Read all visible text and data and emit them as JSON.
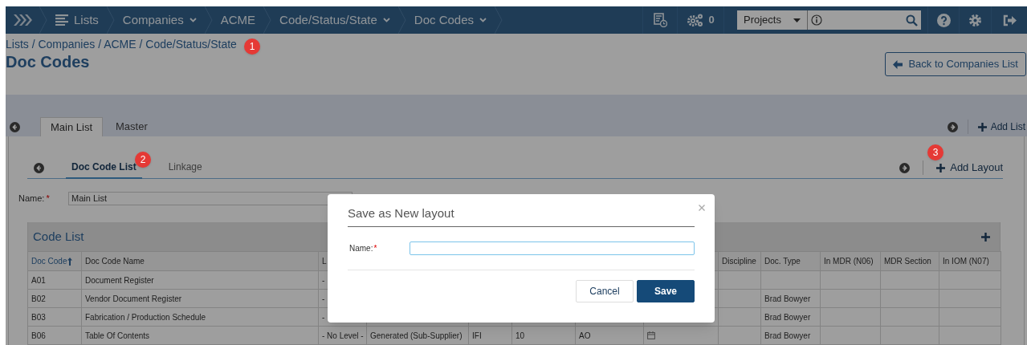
{
  "nav": {
    "items": [
      {
        "label": "Lists",
        "dropdown": false
      },
      {
        "label": "Companies",
        "dropdown": true
      },
      {
        "label": "ACME",
        "dropdown": false
      },
      {
        "label": "Code/Status/State",
        "dropdown": true
      },
      {
        "label": "Doc Codes",
        "dropdown": true
      }
    ],
    "job_count": "0",
    "project_select": "Projects"
  },
  "page": {
    "breadcrumb": "Lists / Companies / ACME / Code/Status/State",
    "title": "Doc Codes",
    "back_button": "Back to Companies List"
  },
  "list_tabs": [
    {
      "label": "Main List",
      "selected": true
    },
    {
      "label": "Master",
      "selected": false
    }
  ],
  "add_list": "Add List",
  "layout_tabs": [
    {
      "label": "Doc Code List",
      "selected": true
    },
    {
      "label": "Linkage",
      "selected": false
    }
  ],
  "add_layout": "Add Layout",
  "name_field": {
    "label": "Name:",
    "required_mark": "*",
    "value": "Main List"
  },
  "table": {
    "title": "Code List",
    "columns": [
      {
        "label": "Doc Code",
        "sorted": true
      },
      {
        "label": "Doc Code Name",
        "sorted": false
      },
      {
        "label": "L",
        "sorted": false
      },
      {},
      {},
      {},
      {},
      {},
      {
        "label": "Discipline",
        "sorted": false
      },
      {
        "label": "Doc. Type",
        "sorted": false
      },
      {
        "label": "In MDR (N06)",
        "sorted": false
      },
      {
        "label": "MDR Section",
        "sorted": false
      },
      {
        "label": "In IOM (N07)",
        "sorted": false
      }
    ],
    "rows": [
      {
        "cells": [
          "A01",
          "Document Register",
          "-",
          null,
          null,
          null,
          null,
          null,
          null,
          null,
          null,
          null,
          null
        ]
      },
      {
        "cells": [
          "B02",
          "Vendor Document Register",
          "-",
          null,
          null,
          null,
          null,
          null,
          null,
          "Brad Bowyer",
          null,
          null,
          null
        ]
      },
      {
        "cells": [
          "B03",
          "Fabrication / Production Schedule",
          "-",
          null,
          null,
          null,
          null,
          null,
          null,
          "Brad Bowyer",
          null,
          null,
          null
        ]
      },
      {
        "cells": [
          "B06",
          "Table Of Contents",
          "- No Level -",
          "Generated (Sub-Supplier)",
          "IFI",
          "10",
          "AO",
          null,
          null,
          "Brad Bowyer",
          null,
          null,
          null
        ],
        "icon_cell": true
      }
    ]
  },
  "dialog": {
    "title": "Save as New layout",
    "name_label": "Name:",
    "required_mark": "*",
    "buttons": [
      {
        "label": "Cancel",
        "kind": "secondary"
      },
      {
        "label": "Save",
        "kind": "primary"
      }
    ]
  },
  "callouts": [
    {
      "label": "1"
    },
    {
      "label": "2"
    },
    {
      "label": "3"
    }
  ]
}
